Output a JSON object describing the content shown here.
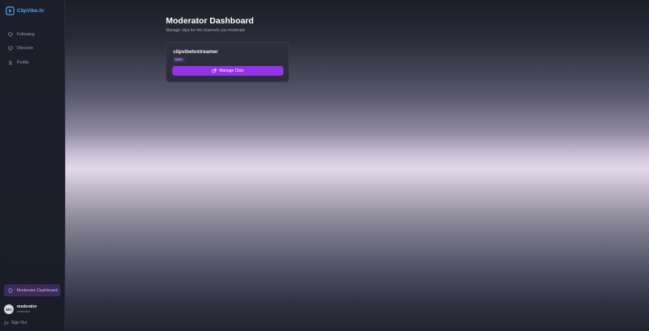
{
  "app": {
    "name": "ClipVibe.tv",
    "accent": "#9333ea",
    "logo_color": "#4ea3e6"
  },
  "sidebar": {
    "items": [
      {
        "label": "Following",
        "icon": "heart-icon"
      },
      {
        "label": "Discover",
        "icon": "heart-icon"
      },
      {
        "label": "Profile",
        "icon": "user-icon"
      }
    ],
    "moderator": {
      "label": "Moderator Dashboard",
      "icon": "shield-icon"
    },
    "user": {
      "initials": "MO",
      "name": "moderator",
      "role": "moderator"
    },
    "signout": {
      "label": "Sign Out",
      "icon": "sign-out-icon"
    }
  },
  "main": {
    "title": "Moderator Dashboard",
    "subtitle": "Manage clips for the channels you moderate",
    "channel": {
      "name": "clipvibetvstreamer",
      "badge": "twitch",
      "button": "Manage Clips",
      "button_icon": "external-link-icon"
    }
  }
}
